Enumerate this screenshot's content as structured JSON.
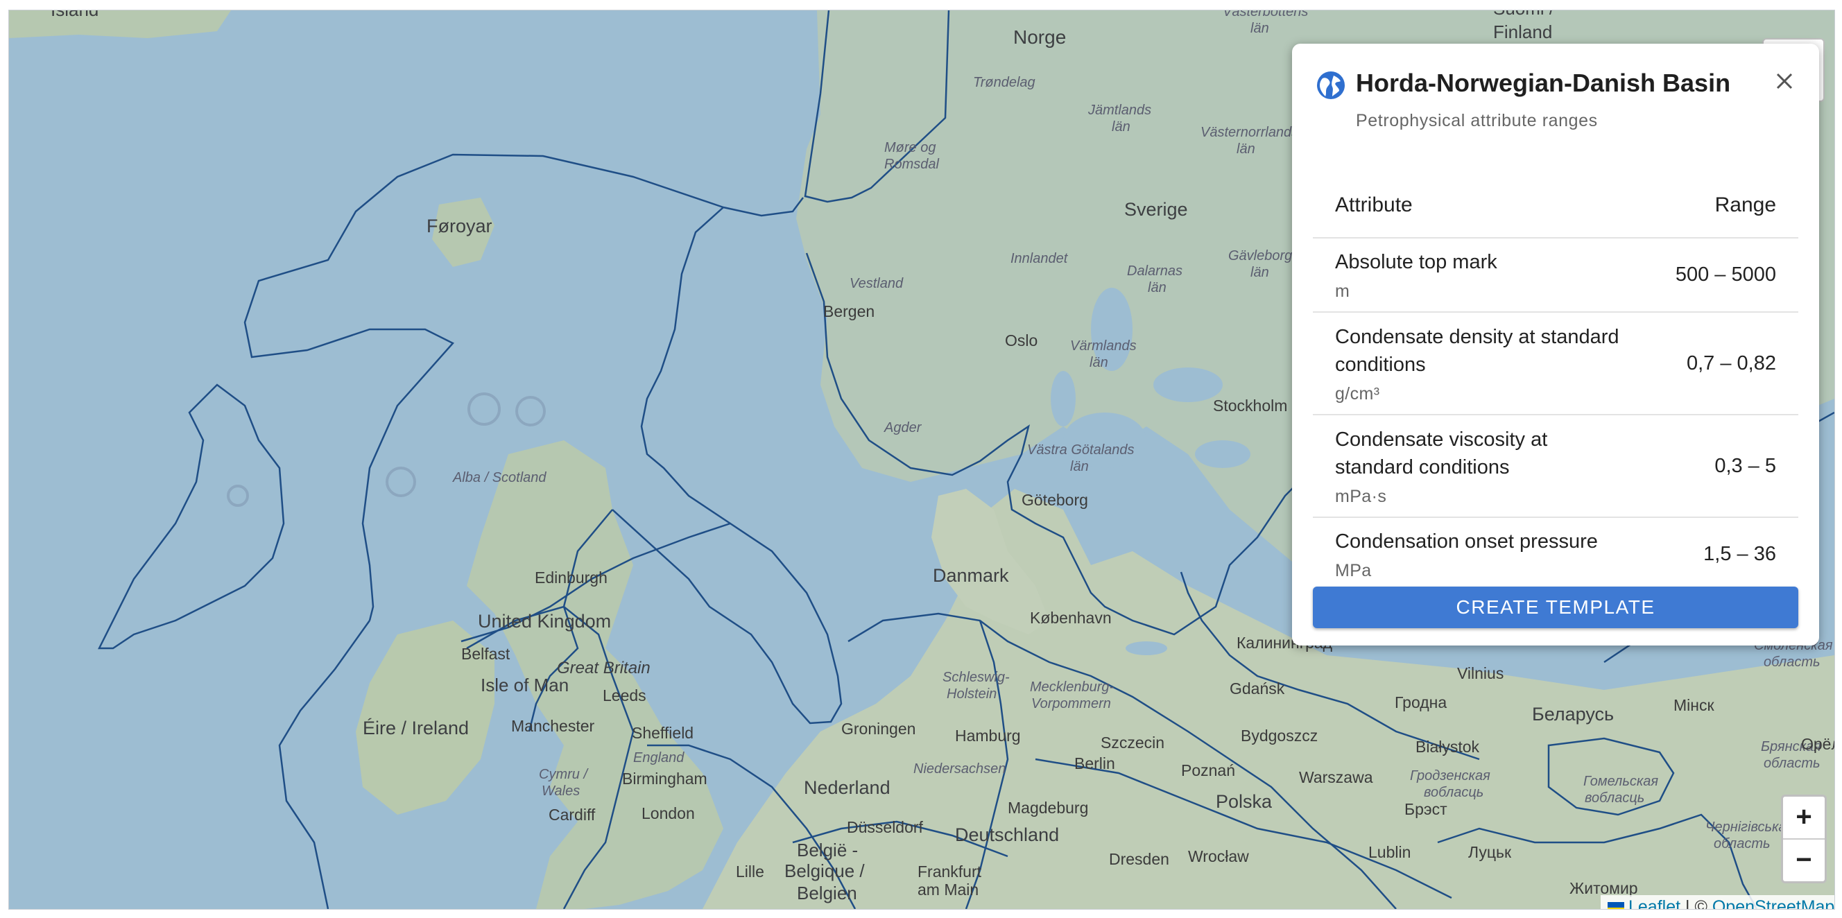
{
  "popup": {
    "title": "Horda-Norwegian-Danish Basin",
    "subtitle": "Petrophysical attribute ranges",
    "table": {
      "header_attribute": "Attribute",
      "header_range": "Range",
      "rows": [
        {
          "name": "Absolute top mark",
          "unit": "m",
          "range": "500 – 5000"
        },
        {
          "name": "Condensate density at standard conditions",
          "unit": "g/cm³",
          "range": "0,7 – 0,82"
        },
        {
          "name": "Condensate viscosity at standard conditions",
          "unit": "mPa·s",
          "range": "0,3 – 5"
        },
        {
          "name": "Condensation onset pressure",
          "unit": "MPa",
          "range": "1,5 – 36"
        }
      ]
    },
    "button_label": "CREATE TEMPLATE"
  },
  "zoom": {
    "in_label": "+",
    "out_label": "−"
  },
  "attribution": {
    "leaflet": "Leaflet",
    "separator": "|",
    "copyright": "©",
    "osm": "OpenStreetMap"
  },
  "map_labels": {
    "island": "Ísland",
    "norge": "Norge",
    "suomi": "Suomi /",
    "finland": "Finland",
    "vasterbottens": "Västerbottens",
    "lan1": "län",
    "trondelag": "Trøndelag",
    "jamtlands": "Jämtlands",
    "lan2": "län",
    "vasternorrlands": "Västernorrlands",
    "lan3": "län",
    "more_og": "Møre og",
    "romsdal": "Romsdal",
    "sverige": "Sverige",
    "foroyar": "Føroyar",
    "innlandet": "Innlandet",
    "dalarnas": "Dalarnas",
    "lan4": "län",
    "gavleborgs": "Gävleborgs",
    "lan5": "län",
    "vestland": "Vestland",
    "bergen": "Bergen",
    "oslo": "Oslo",
    "varmlands": "Värmlands",
    "lan6": "län",
    "stockholm": "Stockholm",
    "agder": "Agder",
    "vastra_gotalands": "Västra Götalands",
    "lan7": "län",
    "alba": "Alba / Scotland",
    "goteborg": "Göteborg",
    "danmark": "Danmark",
    "edinburgh": "Edinburgh",
    "kobenhavn": "København",
    "united_kingdom": "United Kingdom",
    "belfast": "Belfast",
    "great_britain": "Great Britain",
    "isle_of_man": "Isle of Man",
    "leeds": "Leeds",
    "schleswig": "Schleswig-",
    "holstein": "Holstein",
    "mecklenburg": "Mecklenburg-",
    "vorpommern": "Vorpommern",
    "kaliningrad": "Калининград",
    "gdansk": "Gdańsk",
    "vilnius": "Vilnius",
    "smolenskaya": "Смоленская",
    "oblast1": "область",
    "grodno": "Гродна",
    "belarus": "Беларусь",
    "minsk": "Мінск",
    "eire": "Éire / Ireland",
    "manchester": "Manchester",
    "sheffield": "Sheffield",
    "groningen": "Groningen",
    "hamburg": "Hamburg",
    "szczecin": "Szczecin",
    "bydgoszcz": "Bydgoszcz",
    "bialystok": "Białystok",
    "bryanskaya": "Брянская",
    "oblast2": "область",
    "orel": "Орёл",
    "england": "England",
    "cymru": "Cymru /",
    "wales": "Wales",
    "birmingham": "Birmingham",
    "niedersachsen": "Niedersachsen",
    "berlin": "Berlin",
    "poznan": "Poznań",
    "warszawa": "Warszawa",
    "grodzenskaya": "Гродзенская",
    "voblasts": "вобласць",
    "gomelskaya": "Гомельская",
    "voblasts2": "вобласць",
    "nederland": "Nederland",
    "magdeburg": "Magdeburg",
    "polska": "Polska",
    "brest": "Брэст",
    "cardiff": "Cardiff",
    "london": "London",
    "dusseldorf": "Düsseldorf",
    "deutschland": "Deutschland",
    "chernihivska": "Чернігівська",
    "oblast3": "область",
    "belgie": "België -",
    "belgique": "Belgique /",
    "belgien": "Belgien",
    "lille": "Lille",
    "frankfurt": "Frankfurt",
    "am_main": "am Main",
    "dresden": "Dresden",
    "wroclaw": "Wrocław",
    "lublin": "Lublin",
    "lutsk": "Луцьк",
    "zhytomyr": "Житомир"
  }
}
